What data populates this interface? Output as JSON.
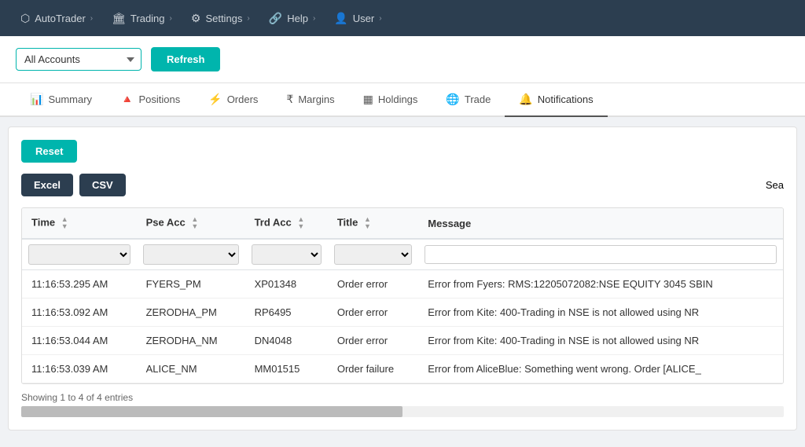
{
  "nav": {
    "items": [
      {
        "id": "autotrader",
        "label": "AutoTrader",
        "icon": "⬡",
        "hasChevron": true
      },
      {
        "id": "trading",
        "label": "Trading",
        "icon": "🏛",
        "hasChevron": true
      },
      {
        "id": "settings",
        "label": "Settings",
        "icon": "⚙",
        "hasChevron": true
      },
      {
        "id": "help",
        "label": "Help",
        "icon": "🔗",
        "hasChevron": true
      },
      {
        "id": "user",
        "label": "User",
        "icon": "👤",
        "hasChevron": true
      }
    ]
  },
  "toolbar": {
    "accounts_default": "All Accounts",
    "refresh_label": "Refresh"
  },
  "tabs": [
    {
      "id": "summary",
      "label": "Summary",
      "icon": "📊",
      "active": false
    },
    {
      "id": "positions",
      "label": "Positions",
      "icon": "🔺",
      "active": false
    },
    {
      "id": "orders",
      "label": "Orders",
      "icon": "⚡",
      "active": false
    },
    {
      "id": "margins",
      "label": "Margins",
      "icon": "₹",
      "active": false
    },
    {
      "id": "holdings",
      "label": "Holdings",
      "icon": "▦",
      "active": false
    },
    {
      "id": "trade",
      "label": "Trade",
      "icon": "🌐",
      "active": false
    },
    {
      "id": "notifications",
      "label": "Notifications",
      "icon": "🔔",
      "active": true
    }
  ],
  "content": {
    "reset_label": "Reset",
    "excel_label": "Excel",
    "csv_label": "CSV",
    "search_label": "Sea",
    "table": {
      "columns": [
        {
          "id": "time",
          "label": "Time",
          "sortable": true
        },
        {
          "id": "pse_acc",
          "label": "Pse Acc",
          "sortable": true
        },
        {
          "id": "trd_acc",
          "label": "Trd Acc",
          "sortable": true
        },
        {
          "id": "title",
          "label": "Title",
          "sortable": true
        },
        {
          "id": "message",
          "label": "Message",
          "sortable": false
        }
      ],
      "rows": [
        {
          "time": "11:16:53.295 AM",
          "pse_acc": "FYERS_PM",
          "trd_acc": "XP01348",
          "title": "Order error",
          "message": "Error from Fyers: RMS:12205072082:NSE EQUITY 3045 SBIN"
        },
        {
          "time": "11:16:53.092 AM",
          "pse_acc": "ZERODHA_PM",
          "trd_acc": "RP6495",
          "title": "Order error",
          "message": "Error from Kite: 400-Trading in NSE is not allowed using NR"
        },
        {
          "time": "11:16:53.044 AM",
          "pse_acc": "ZERODHA_NM",
          "trd_acc": "DN4048",
          "title": "Order error",
          "message": "Error from Kite: 400-Trading in NSE is not allowed using NR"
        },
        {
          "time": "11:16:53.039 AM",
          "pse_acc": "ALICE_NM",
          "trd_acc": "MM01515",
          "title": "Order failure",
          "message": "Error from AliceBlue: Something went wrong. Order [ALICE_"
        }
      ],
      "pagination": "Showing 1 to 4 of 4 entries"
    }
  }
}
